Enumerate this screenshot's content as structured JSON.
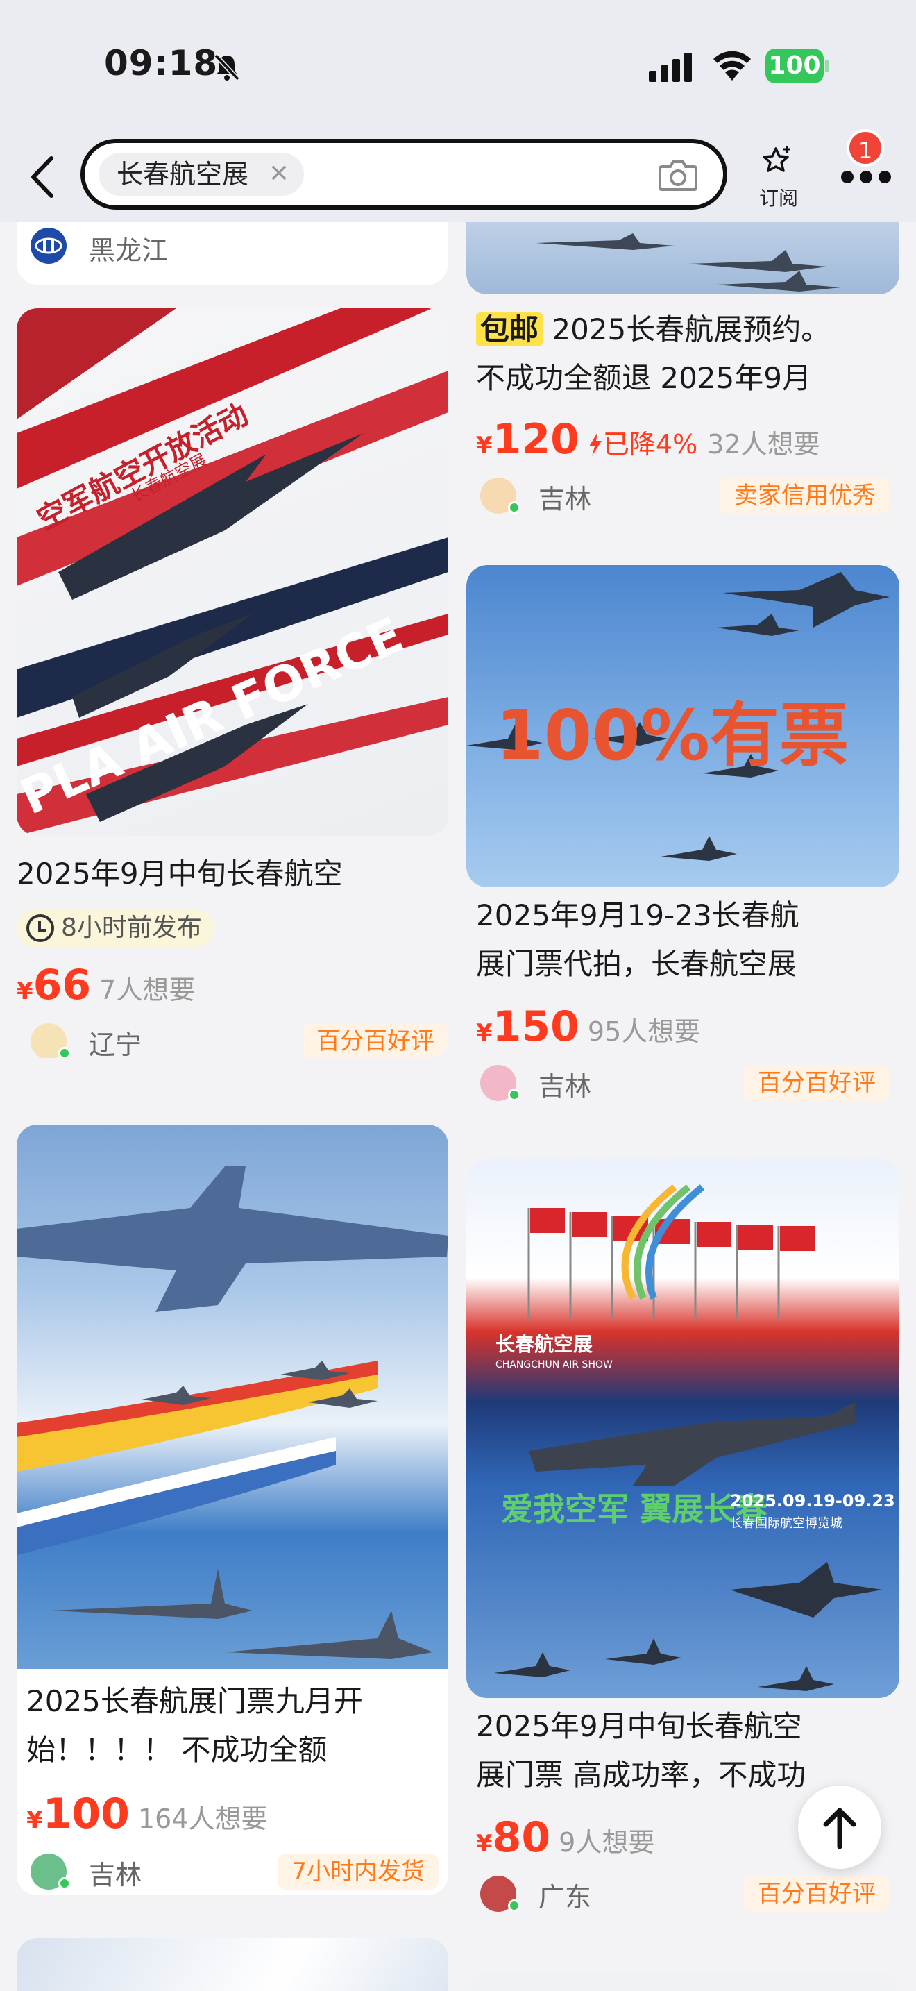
{
  "status_bar": {
    "time": "09:18",
    "battery": "100"
  },
  "header": {
    "search_query": "长春航空展",
    "subscribe_label": "订阅",
    "message_badge": "1"
  },
  "feed": {
    "top_left_partial": {
      "location": "黑龙江"
    },
    "left_1": {
      "thumb_text_1": "空军航空开放活动",
      "thumb_text_2": "长春航空展",
      "thumb_text_3": "PLA AIR FORCE",
      "title": "2025年9月中旬长春航空",
      "time_tag": "8小时前发布",
      "yen": "¥",
      "price": "66",
      "wants": "7人想要",
      "location": "辽宁",
      "tag": "百分百好评"
    },
    "left_2": {
      "title_line1": "2025长春航展门票九月开",
      "title_line2": "始！！！！ 不成功全额",
      "yen": "¥",
      "price": "100",
      "wants": "164人想要",
      "location": "吉林",
      "tag": "7小时内发货"
    },
    "right_0": {
      "badge": "包邮",
      "title_line1": " 2025长春航展预约。",
      "title_line2": "不成功全额退 2025年9月",
      "yen": "¥",
      "price": "120",
      "drop": "已降4%",
      "wants": "32人想要",
      "location": "吉林",
      "tag": "卖家信用优秀"
    },
    "right_1": {
      "thumb_text": "100%有票",
      "title_line1": "2025年9月19-23长春航",
      "title_line2": "展门票代拍，长春航空展",
      "yen": "¥",
      "price": "150",
      "wants": "95人想要",
      "location": "吉林",
      "tag": "百分百好评"
    },
    "right_2": {
      "thumb_logo": "长春航空展",
      "thumb_logo_en": "CHANGCHUN AIR SHOW",
      "thumb_slogan": "爱我空军 翼展长春",
      "thumb_dates": "2025.09.19-09.23",
      "thumb_venue": "长春国际航空博览城",
      "title_line1": "2025年9月中旬长春航空",
      "title_line2": "展门票 高成功率，不成功",
      "yen": "¥",
      "price": "80",
      "wants": "9人想要",
      "location": "广东",
      "tag": "百分百好评"
    }
  },
  "colors": {
    "price_red": "#ff3b1f",
    "tag_orange": "#ff7a1a",
    "online_green": "#34c759",
    "badge_red": "#f04438"
  }
}
